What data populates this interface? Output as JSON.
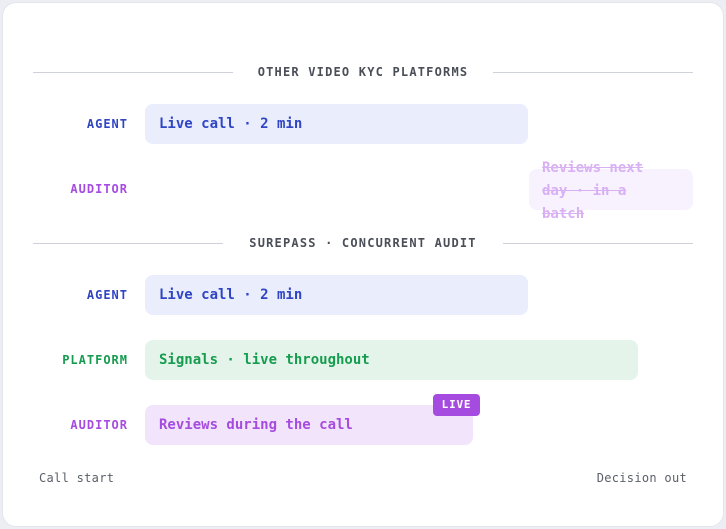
{
  "sections": {
    "other": {
      "title": "OTHER VIDEO KYC PLATFORMS",
      "agent": {
        "label": "AGENT",
        "bar_text": "Live call · 2 min"
      },
      "auditor": {
        "label": "AUDITOR",
        "bar_text": "Reviews next day · in a batch"
      }
    },
    "surepass": {
      "title": "SUREPASS · CONCURRENT AUDIT",
      "agent": {
        "label": "AGENT",
        "bar_text": "Live call · 2 min"
      },
      "platform": {
        "label": "PLATFORM",
        "bar_text": "Signals · live throughout"
      },
      "auditor": {
        "label": "AUDITOR",
        "bar_text": "Reviews during the call",
        "badge": "LIVE"
      }
    }
  },
  "axis": {
    "start": "Call start",
    "end": "Decision out"
  },
  "colors": {
    "agent_text": "#2f45c4",
    "agent_bg": "#e9edfc",
    "auditor_text": "#a64be0",
    "auditor_bg": "#f1e4fb",
    "platform_text": "#169c4f",
    "platform_bg": "#e5f4ea",
    "ghost_text": "#d8b0f3",
    "badge_bg": "#a64be0"
  }
}
